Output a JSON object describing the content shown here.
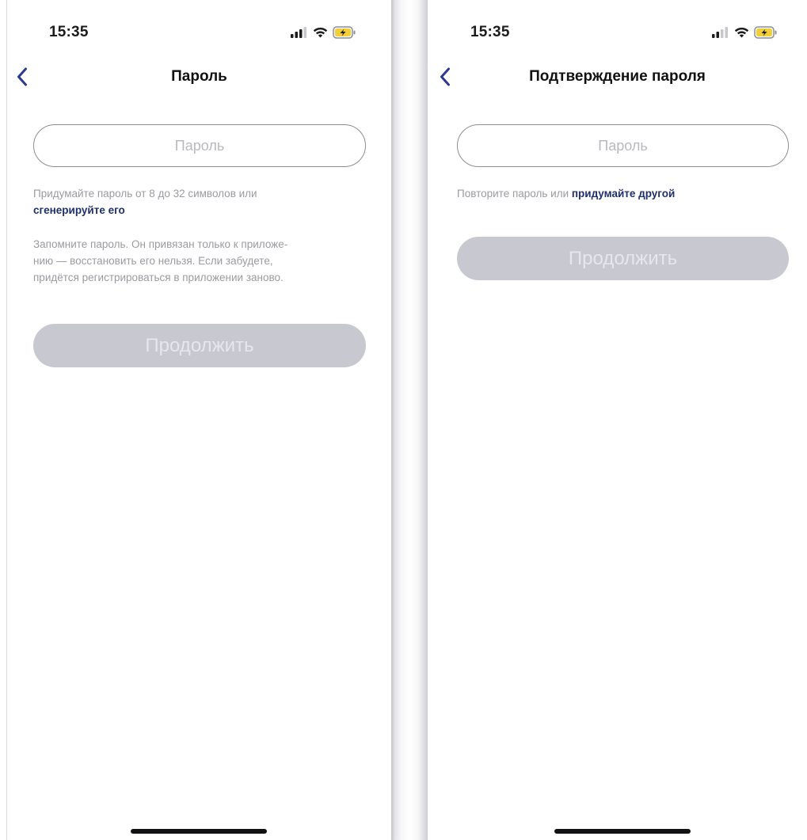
{
  "screens": {
    "password": {
      "status_time": "15:35",
      "title": "Пароль",
      "field_placeholder": "Пароль",
      "hint_text": "Придумайте пароль от 8 до 32 символов или",
      "generate_link": "сгенерируйте его",
      "note_line_1": "Запомните пароль. Он привязан только к приложе-",
      "note_line_2": "нию — восстановить его нельзя. Если забудете,",
      "note_line_3": "придётся регистрироваться в приложении заново.",
      "continue_label": "Продолжить"
    },
    "confirm": {
      "status_time": "15:35",
      "title": "Подтверждение пароля",
      "field_placeholder": "Пароль",
      "hint_text": "Повторите пароль или ",
      "other_link": "придумайте другой",
      "continue_label": "Продолжить"
    }
  },
  "icons": {
    "back": "chevron-left-icon",
    "signal": "cellular-signal-icon",
    "wifi": "wifi-icon",
    "battery": "battery-charging-icon"
  },
  "colors": {
    "accent": "#1f2f6e",
    "button_disabled_bg": "#c8c9d0",
    "button_disabled_text": "#e6e7ec",
    "hint_text": "#9a9aa0",
    "field_border": "#8e8e93",
    "placeholder": "#b8b8bd",
    "back_arrow": "#2b3a8f"
  }
}
